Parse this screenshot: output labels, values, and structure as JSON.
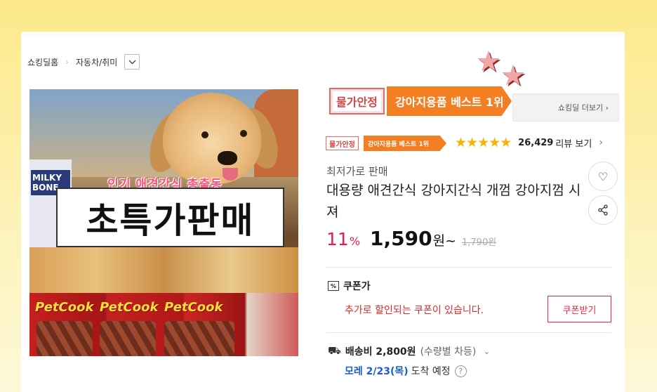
{
  "breadcrumb": {
    "home": "쇼킹딜홈",
    "separator": "›",
    "category": "자동차/취미",
    "dropdown_icon": "chevron-down-icon"
  },
  "product_image": {
    "subtitle": "인기 애견간식 총출동",
    "title": "초특가판매",
    "left_pack_text": "MILKY BONE",
    "brand_1": "PetCook",
    "brand_2": "PetCook",
    "brand_3": "PetCook"
  },
  "badges": {
    "price_stable": "물가안정",
    "best": "강아지용품 베스트 1위",
    "more": "쇼킹딜 더보기 ›",
    "star_icon": "star-icon"
  },
  "rating": {
    "stars": "★★★★★",
    "value": 4.5,
    "review_count": "26,429",
    "review_link": "리뷰 보기",
    "chevron": "›"
  },
  "product": {
    "seller": "최저가로 판매",
    "title": "대용량 애견간식 강아지간식 개껌 강아지껌 시져"
  },
  "actions": {
    "wish_icon": "♡",
    "share_icon": "⋖"
  },
  "price": {
    "discount": "11",
    "discount_unit": "%",
    "sale": "1,590",
    "sale_unit": "원~",
    "original": "1,790원"
  },
  "coupon": {
    "icon": "%",
    "label": "쿠폰가",
    "text": "추가로 할인되는 쿠폰이 있습니다.",
    "button": "쿠폰받기"
  },
  "shipping": {
    "icon": "⛟",
    "fee": "배송비 2,800원",
    "note": "(수량별 차등)",
    "chevron": "⌄",
    "delivery_date": "모레 2/23(목)",
    "delivery_text": "도착 예정",
    "help": "?"
  },
  "colors": {
    "accent_red": "#e21d4e",
    "best_orange": "#f47e22",
    "delivery_blue": "#1a5fd0",
    "star_gold": "#f5b40a"
  }
}
